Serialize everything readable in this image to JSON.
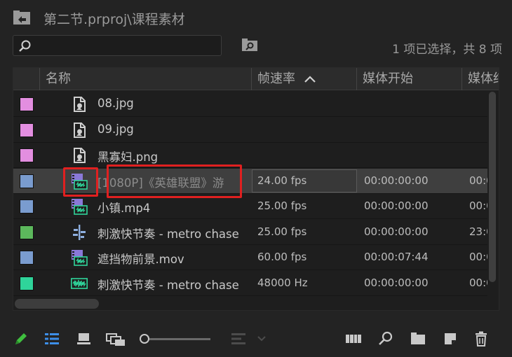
{
  "titlebar": {
    "title": "第二节.prproj\\课程素材"
  },
  "search": {
    "placeholder": "",
    "selection_count": "1 项已选择，共 8 项"
  },
  "table": {
    "headers": {
      "name": "名称",
      "framerate": "帧速率",
      "media_start": "媒体开始",
      "media_end": "媒体结"
    },
    "rows": [
      {
        "name": "08.jpg",
        "color": "#e38ee0",
        "icon": "image-file-icon",
        "framerate": "",
        "media_start": "",
        "media_end": "",
        "selected": false
      },
      {
        "name": "09.jpg",
        "color": "#e38ee0",
        "icon": "image-file-icon",
        "framerate": "",
        "media_start": "",
        "media_end": "",
        "selected": false
      },
      {
        "name": "黑寡妇.png",
        "color": "#e38ee0",
        "icon": "image-file-icon",
        "framerate": "",
        "media_start": "",
        "media_end": "",
        "selected": false
      },
      {
        "name": "[1080P]《英雄联盟》游",
        "color": "#7a9ccf",
        "icon": "video-clip-icon",
        "framerate": "24.00 fps",
        "media_start": "00:00:00:00",
        "media_end": "00:0",
        "selected": true
      },
      {
        "name": "小镇.mp4",
        "color": "#7a9ccf",
        "icon": "video-clip-icon",
        "framerate": "25.00 fps",
        "media_start": "00:00:00:00",
        "media_end": "00:0",
        "selected": false
      },
      {
        "name": "刺激快节奏 - metro chase",
        "color": "#5cb85c",
        "icon": "multicam-sequence-icon",
        "framerate": "25.00 fps",
        "media_start": "00:00:00:00",
        "media_end": "23:0",
        "selected": false
      },
      {
        "name": "遮挡物前景.mov",
        "color": "#7a9ccf",
        "icon": "video-clip-icon",
        "framerate": "60.00 fps",
        "media_start": "00:00:07:44",
        "media_end": "00:0",
        "selected": false
      },
      {
        "name": "刺激快节奏 - metro chase",
        "color": "#2fd49a",
        "icon": "audio-clip-icon",
        "framerate": "48000 Hz",
        "media_start": "00:00:00:00",
        "media_end": "00:0",
        "selected": false
      }
    ]
  },
  "bottom_toolbar": {
    "icons": [
      "pencil-icon",
      "list-view-icon",
      "icon-view-icon",
      "freeform-view-icon",
      "zoom-slider",
      "sort-icons-icon",
      "automate-to-sequence-icon",
      "find-icon",
      "new-bin-icon",
      "new-item-icon",
      "trash-icon"
    ]
  },
  "colors": {
    "selection_highlight": "#e02020",
    "background": "#232323",
    "accent_blue": "#3d8ee8",
    "pencil_green": "#3fbf3f"
  }
}
